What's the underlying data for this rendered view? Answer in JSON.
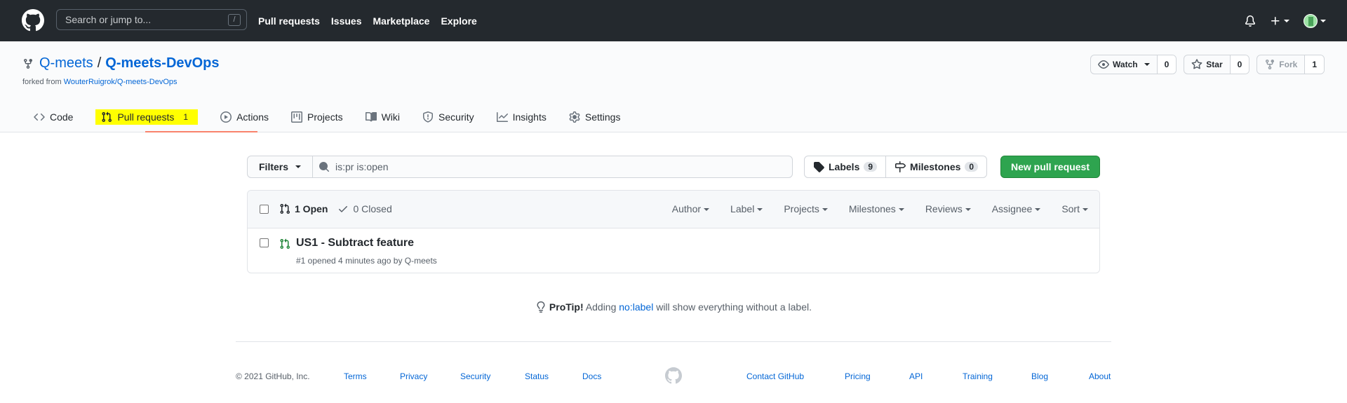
{
  "header": {
    "search_placeholder": "Search or jump to...",
    "search_key": "/",
    "nav": [
      "Pull requests",
      "Issues",
      "Marketplace",
      "Explore"
    ]
  },
  "repo": {
    "owner": "Q-meets",
    "separator": "/",
    "name": "Q-meets-DevOps",
    "forked_prefix": "forked from",
    "forked_from": "WouterRuigrok/Q-meets-DevOps",
    "watch_label": "Watch",
    "watch_count": "0",
    "star_label": "Star",
    "star_count": "0",
    "fork_label": "Fork",
    "fork_count": "1"
  },
  "tabs": [
    {
      "label": "Code",
      "icon": "code-icon"
    },
    {
      "label": "Pull requests",
      "icon": "git-pull-request-icon",
      "count": "1"
    },
    {
      "label": "Actions",
      "icon": "play-icon"
    },
    {
      "label": "Projects",
      "icon": "project-icon"
    },
    {
      "label": "Wiki",
      "icon": "book-icon"
    },
    {
      "label": "Security",
      "icon": "shield-icon"
    },
    {
      "label": "Insights",
      "icon": "graph-icon"
    },
    {
      "label": "Settings",
      "icon": "gear-icon"
    }
  ],
  "filterbar": {
    "filters_label": "Filters",
    "query": "is:pr is:open",
    "labels_label": "Labels",
    "labels_count": "9",
    "milestones_label": "Milestones",
    "milestones_count": "0",
    "new_pr_label": "New pull request"
  },
  "list": {
    "open_label": "1 Open",
    "closed_label": "0 Closed",
    "sort_menus": [
      "Author",
      "Label",
      "Projects",
      "Milestones",
      "Reviews",
      "Assignee",
      "Sort"
    ],
    "items": [
      {
        "title": "US1 - Subtract feature",
        "meta": "#1 opened 4 minutes ago by Q-meets"
      }
    ]
  },
  "protip": {
    "strong": "ProTip!",
    "before": "Adding",
    "link": "no:label",
    "after": "will show everything without a label."
  },
  "footer": {
    "copyright": "© 2021 GitHub, Inc.",
    "links": [
      "Terms",
      "Privacy",
      "Security",
      "Status",
      "Docs",
      "Contact GitHub",
      "Pricing",
      "API",
      "Training",
      "Blog",
      "About"
    ]
  },
  "colors": {
    "header_bg": "#24292e",
    "link": "#0366d6",
    "primary_button": "#2ea44f",
    "tab_highlight": "#ffff00",
    "tab_underline": "#f9826c"
  }
}
